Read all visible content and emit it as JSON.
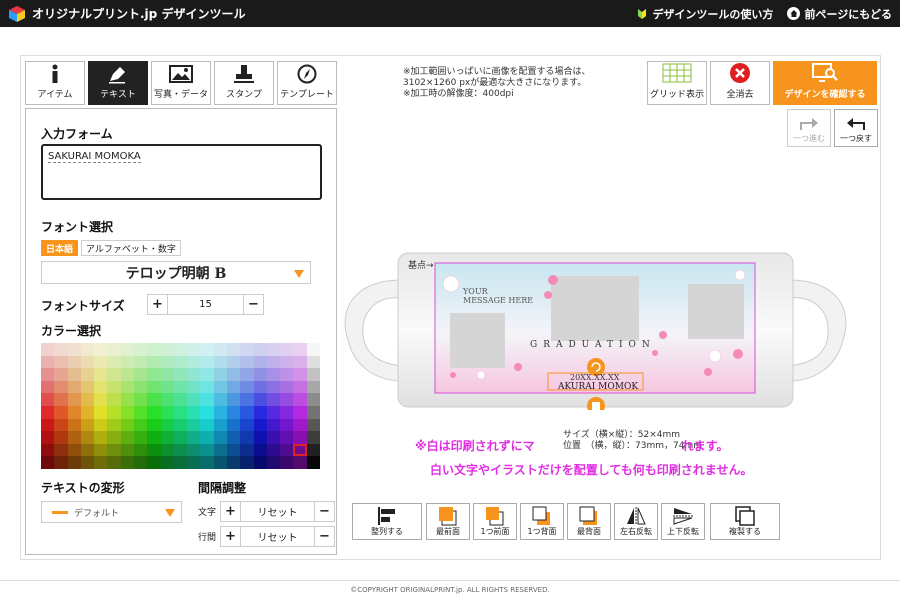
{
  "header": {
    "logo_text": "オリジナルプリント.jp デザインツール",
    "howto_link": "デザインツールの使い方",
    "back_link": "前ページにもどる"
  },
  "tabs": [
    {
      "label": "アイテム",
      "icon": "info-icon",
      "active": false
    },
    {
      "label": "テキスト",
      "icon": "pen-icon",
      "active": true
    },
    {
      "label": "写真・データ",
      "icon": "image-icon",
      "active": false
    },
    {
      "label": "スタンプ",
      "icon": "stamp-icon",
      "active": false
    },
    {
      "label": "テンプレート",
      "icon": "compass-icon",
      "active": false
    }
  ],
  "panel": {
    "input_form_label": "入力フォーム",
    "input_value": "SAKURAI MOMOKA",
    "font_select_label": "フォント選択",
    "lang_japanese": "日本語",
    "lang_alpha": "アルファベット・数字",
    "font_name": "テロップ明朝 B",
    "font_size_label": "フォントサイズ",
    "font_size_value": "15",
    "color_label": "カラー選択",
    "transform_label": "テキストの変形",
    "transform_value": "デフォルト",
    "spacing_label": "間隔調整",
    "char_label": "文字",
    "line_label": "行間",
    "reset_label": "リセット",
    "plus": "+",
    "minus": "−"
  },
  "notice": {
    "line1": "※加工範囲いっぱいに画像を配置する場合は、",
    "line2": "3102×1260 pxが最適な大きさになります。",
    "line3": "※加工時の解像度：400dpi"
  },
  "tools": {
    "grid": "グリッド表示",
    "clear": "全消去",
    "confirm": "デザインを確認する",
    "redo": "一つ進む",
    "undo": "一つ戻す"
  },
  "canvas": {
    "kiten": "基点→",
    "message": "YOUR\nMESSAGE HERE",
    "graduation": "GRADUATION",
    "date": "20XX.XX.XX",
    "name": "AKURAI MOMOK",
    "size_line": "サイズ（横×縦）：52×4mm",
    "position_line": "位置　（横，縦）：73mm，74mm"
  },
  "warnings": {
    "line1": "※白は印刷されずにマ",
    "line1b": "れます。",
    "line2": "白い文字やイラストだけを配置しても何も印刷されません。"
  },
  "bottom_buttons": [
    {
      "label": "整列する"
    },
    {
      "label": "最前面"
    },
    {
      "label": "1つ前面"
    },
    {
      "label": "1つ背面"
    },
    {
      "label": "最背面"
    },
    {
      "label": "左右反転"
    },
    {
      "label": "上下反転"
    },
    {
      "label": "複製する"
    }
  ],
  "footer": "©COPYRIGHT ORIGINALPRINT.jp. ALL RIGHTS RESERVED.",
  "colors": {
    "accent": "#f7941d",
    "warning": "#e22ee2",
    "dark": "#1a1a1a"
  }
}
